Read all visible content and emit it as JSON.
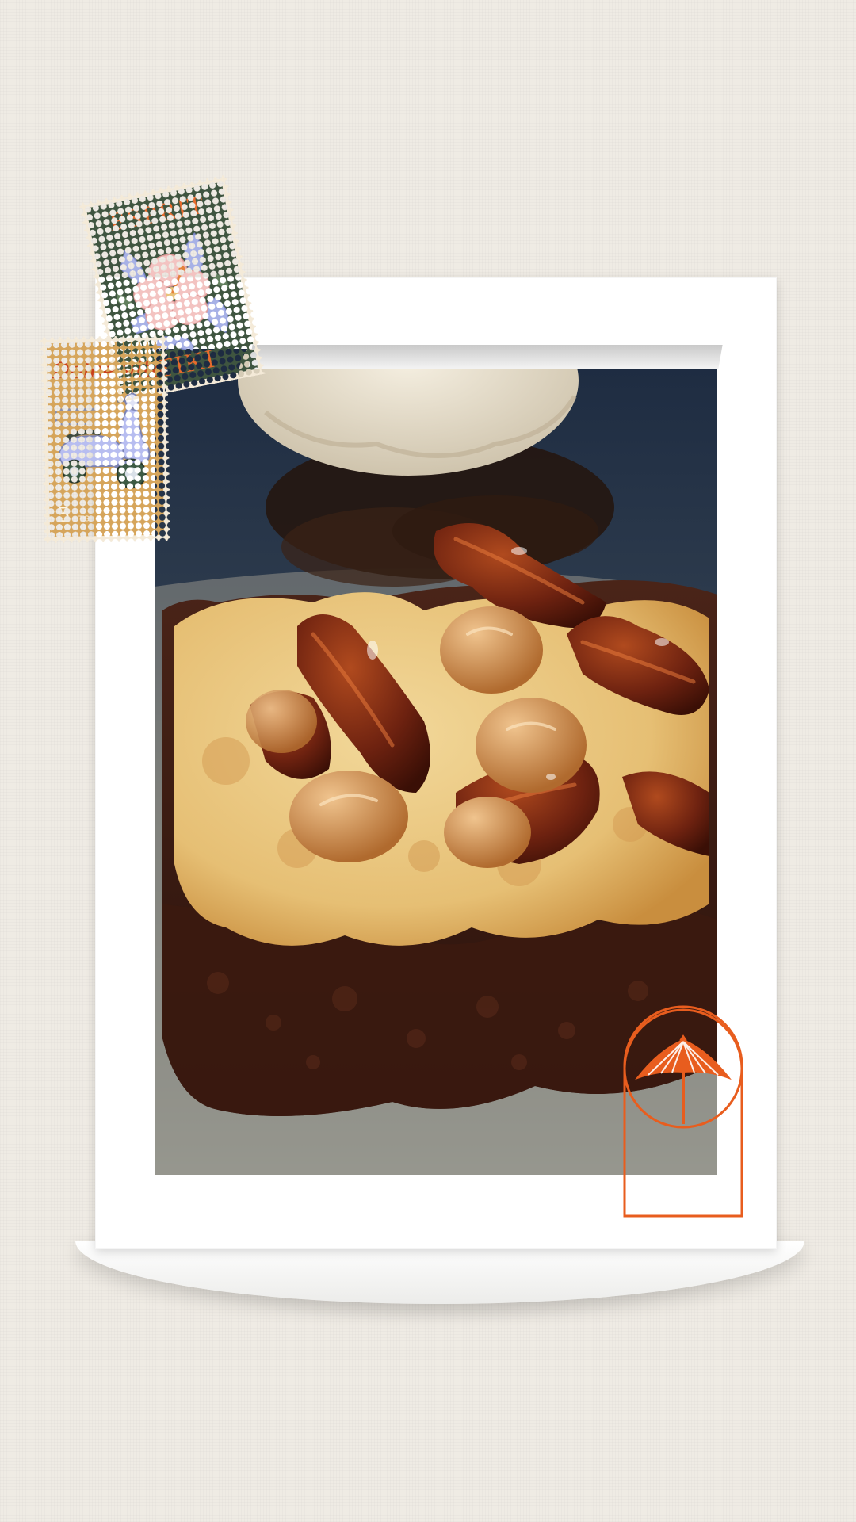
{
  "scene": "Polaroid-style photo card of a pecan caramel brownie with ice cream, decorated with vintage stamps",
  "stamps": [
    {
      "top_word": "ESPRIT",
      "bottom_word": "TIKI",
      "image": "hibiscus-flower-icon"
    },
    {
      "script": "Dolce vita",
      "price_value": "5",
      "price_unit": "CTS",
      "image": "scooter-icon"
    }
  ],
  "badge": {
    "image": "parasol-icon"
  },
  "colors": {
    "background": "#efebe4",
    "card": "#ffffff",
    "accent_orange": "#e85d1e",
    "stamp_green": "#3f5540",
    "stamp_mustard": "#d6a55b"
  }
}
